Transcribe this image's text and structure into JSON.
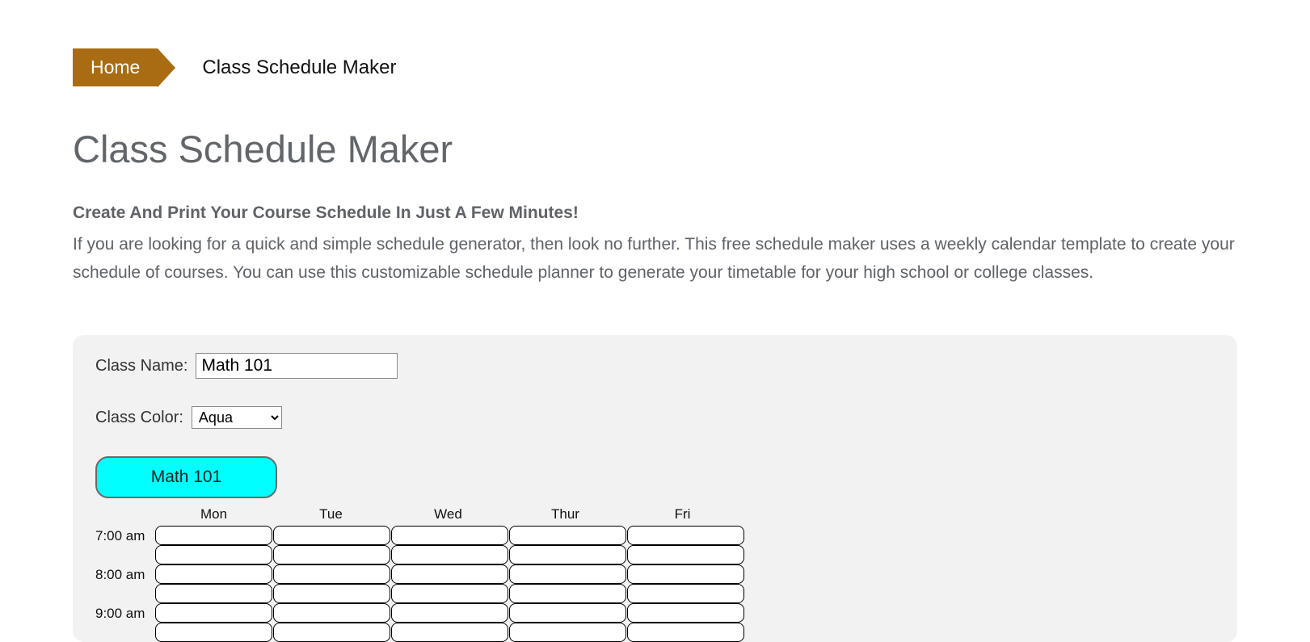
{
  "breadcrumb": {
    "home": "Home",
    "current": "Class Schedule Maker"
  },
  "title": "Class Schedule Maker",
  "lead": "Create And Print Your Course Schedule In Just A Few Minutes!",
  "desc": "If you are looking for a quick and simple schedule generator, then look no further. This free schedule maker uses a weekly calendar template to create your schedule of courses. You can use this customizable schedule planner to generate your timetable for your high school or college classes.",
  "form": {
    "class_name_label": "Class Name:",
    "class_name_value": "Math 101",
    "class_color_label": "Class Color:",
    "class_color_value": "Aqua"
  },
  "chip": {
    "label": "Math 101"
  },
  "schedule": {
    "days": [
      "Mon",
      "Tue",
      "Wed",
      "Thur",
      "Fri"
    ],
    "times": [
      "7:00 am",
      "8:00 am",
      "9:00 am"
    ]
  }
}
